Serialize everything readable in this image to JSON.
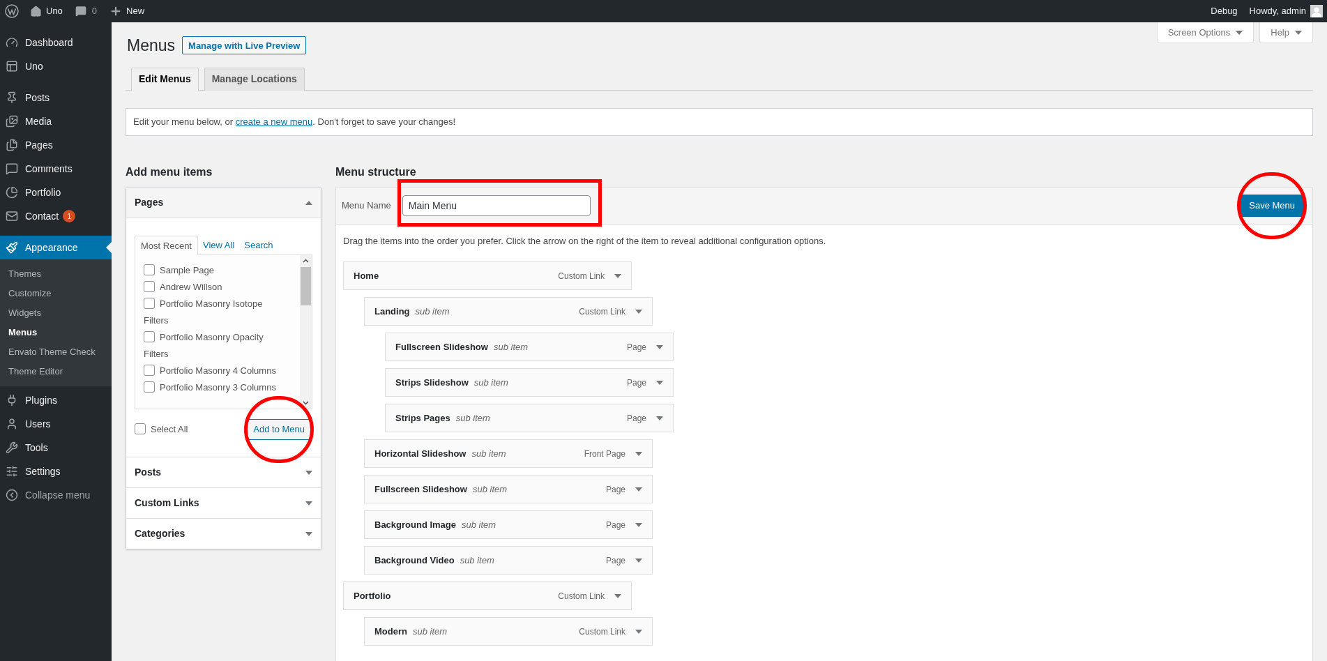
{
  "top_bar": {
    "site": "Uno",
    "comments": "0",
    "new": "New",
    "debug": "Debug",
    "greeting": "Howdy, admin"
  },
  "sidebar": {
    "groups": [
      {
        "items": [
          {
            "kind": "link",
            "label": "Dashboard",
            "selected": false
          },
          {
            "kind": "link",
            "label": "Uno",
            "selected": false
          }
        ]
      },
      {
        "items": [
          {
            "kind": "link",
            "label": "Posts",
            "selected": false
          },
          {
            "kind": "link",
            "label": "Media",
            "selected": false
          },
          {
            "kind": "link",
            "label": "Pages",
            "selected": false
          },
          {
            "kind": "link",
            "label": "Comments",
            "selected": false
          },
          {
            "kind": "link",
            "label": "Portfolio",
            "selected": false
          },
          {
            "kind": "link",
            "label": "Contact",
            "selected": false,
            "badge": "1"
          }
        ]
      },
      {
        "items": [
          {
            "kind": "link",
            "label": "Appearance",
            "selected": true,
            "children": [
              {
                "label": "Themes",
                "selected": false
              },
              {
                "label": "Customize",
                "selected": false
              },
              {
                "label": "Widgets",
                "selected": false
              },
              {
                "label": "Menus",
                "selected": true
              },
              {
                "label": "Envato Theme Check",
                "selected": false
              },
              {
                "label": "Theme Editor",
                "selected": false
              }
            ]
          },
          {
            "kind": "link",
            "label": "Plugins",
            "selected": false
          },
          {
            "kind": "link",
            "label": "Users",
            "selected": false
          },
          {
            "kind": "link",
            "label": "Tools",
            "selected": false
          },
          {
            "kind": "link",
            "label": "Settings",
            "selected": false
          },
          {
            "kind": "collapse",
            "label": "Collapse menu",
            "selected": false
          }
        ]
      }
    ]
  },
  "screen_buttons": [
    "Screen Options",
    "Help"
  ],
  "page": {
    "title": "Menus",
    "action": "Manage with Live Preview",
    "tabs": [
      {
        "label": "Edit Menus",
        "selected": true
      },
      {
        "label": "Manage Locations",
        "selected": false
      }
    ],
    "notice": {
      "before": "Edit your menu below, or ",
      "link": "create a new menu",
      "after": ". Don't forget to save your changes!"
    }
  },
  "add_items": {
    "heading": "Add menu items",
    "panels": [
      {
        "title": "Pages",
        "expanded": true,
        "tabs": [
          {
            "label": "Most Recent",
            "selected": true
          },
          {
            "label": "View All",
            "selected": false
          },
          {
            "label": "Search",
            "selected": false
          }
        ],
        "items": [
          {
            "label": "Sample Page",
            "checked": false
          },
          {
            "label": "Andrew Willson",
            "checked": false
          },
          {
            "label": "Portfolio Masonry Isotope Filters",
            "checked": false
          },
          {
            "label": "Portfolio Masonry Opacity Filters",
            "checked": false
          },
          {
            "label": "Portfolio Masonry 4 Columns",
            "checked": false
          },
          {
            "label": "Portfolio Masonry 3 Columns",
            "checked": false
          }
        ],
        "select_all": {
          "label": "Select All",
          "checked": false
        },
        "button": {
          "label": "Add to Menu",
          "highlighted": true
        }
      },
      {
        "title": "Posts",
        "expanded": false
      },
      {
        "title": "Custom Links",
        "expanded": false
      },
      {
        "title": "Categories",
        "expanded": false
      }
    ]
  },
  "menu_structure": {
    "heading": "Menu structure",
    "name_label": "Menu Name",
    "name_value": "Main Menu",
    "name_highlighted": true,
    "save_button": {
      "label": "Save Menu",
      "highlighted": true
    },
    "instructions": "Drag the items into the order you prefer. Click the arrow on the right of the item to reveal additional configuration options.",
    "items": [
      {
        "title": "Home",
        "type": "Custom Link",
        "children": [
          {
            "title": "Landing",
            "note": "sub item",
            "type": "Custom Link",
            "children": [
              {
                "title": "Fullscreen Slideshow",
                "note": "sub item",
                "type": "Page"
              },
              {
                "title": "Strips Slideshow",
                "note": "sub item",
                "type": "Page"
              },
              {
                "title": "Strips Pages",
                "note": "sub item",
                "type": "Page"
              }
            ]
          },
          {
            "title": "Horizontal Slideshow",
            "note": "sub item",
            "type": "Front Page"
          },
          {
            "title": "Fullscreen Slideshow",
            "note": "sub item",
            "type": "Page"
          },
          {
            "title": "Background Image",
            "note": "sub item",
            "type": "Page"
          },
          {
            "title": "Background Video",
            "note": "sub item",
            "type": "Page"
          }
        ]
      },
      {
        "title": "Portfolio",
        "type": "Custom Link",
        "children": [
          {
            "title": "Modern",
            "note": "sub item",
            "type": "Custom Link"
          }
        ]
      }
    ]
  }
}
